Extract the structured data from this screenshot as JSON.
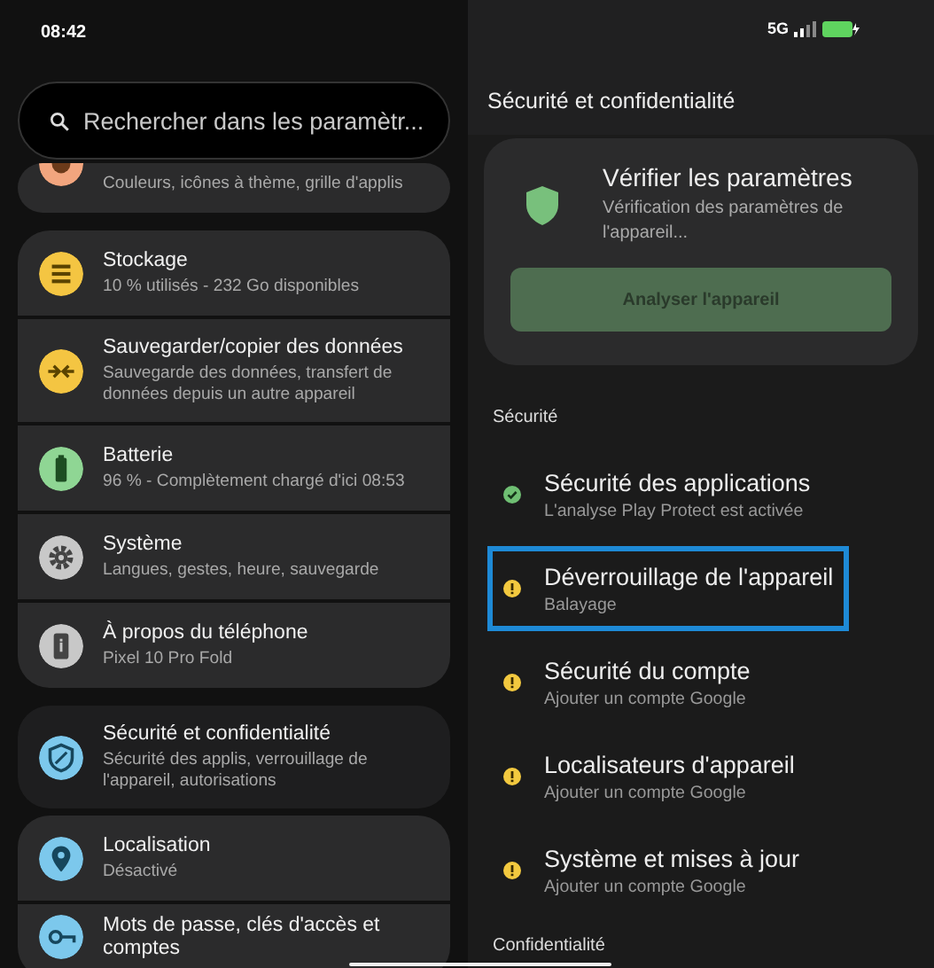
{
  "status_bar": {
    "time": "08:42",
    "network": "5G"
  },
  "search": {
    "placeholder": "Rechercher dans les paramètr..."
  },
  "settings_groups": [
    [
      {
        "kind": "wallpaper",
        "color": "#f2a57e",
        "subtitle": "Couleurs, icônes à thème, grille d'applis",
        "selected": false
      }
    ],
    [
      {
        "kind": "storage",
        "color": "#f4c542",
        "title": "Stockage",
        "subtitle": "10 % utilisés - 232 Go disponibles",
        "selected": false
      },
      {
        "kind": "backup",
        "color": "#f4c542",
        "title": "Sauvegarder/copier des données",
        "subtitle": "Sauvegarde des données, transfert de données depuis un autre appareil",
        "selected": false
      },
      {
        "kind": "battery",
        "color": "#8fd694",
        "title": "Batterie",
        "subtitle": "96 % - Complètement chargé d'ici 08:53",
        "selected": false
      },
      {
        "kind": "system",
        "color": "#c8c8c8",
        "title": "Système",
        "subtitle": "Langues, gestes, heure, sauvegarde",
        "selected": false
      },
      {
        "kind": "about",
        "color": "#c8c8c8",
        "title": "À propos du téléphone",
        "subtitle": "Pixel 10 Pro Fold",
        "selected": false
      }
    ],
    [
      {
        "kind": "security",
        "color": "#7cc8ec",
        "title": "Sécurité et confidentialité",
        "subtitle": "Sécurité des applis, verrouillage de l'appareil, autorisations",
        "selected": true
      }
    ],
    [
      {
        "kind": "location",
        "color": "#7cc8ec",
        "title": "Localisation",
        "subtitle": "Désactivé",
        "selected": false
      },
      {
        "kind": "passwords",
        "color": "#7cc8ec",
        "title": "Mots de passe, clés d'accès et comptes",
        "selected": false
      }
    ]
  ],
  "detail": {
    "title": "Sécurité et confidentialité",
    "check_card": {
      "title": "Vérifier les paramètres",
      "subtitle": "Vérification des paramètres de l'appareil...",
      "button": "Analyser l'appareil",
      "button_disabled": true
    },
    "sections": [
      {
        "heading": "Sécurité",
        "items": [
          {
            "kind": "ok",
            "title": "Sécurité des applications",
            "subtitle": "L'analyse Play Protect est activée",
            "selected": false
          },
          {
            "kind": "warning",
            "title": "Déverrouillage de l'appareil",
            "subtitle": "Balayage",
            "selected": true
          },
          {
            "kind": "warning",
            "title": "Sécurité du compte",
            "subtitle": "Ajouter un compte Google",
            "selected": false
          },
          {
            "kind": "warning",
            "title": "Localisateurs d'appareil",
            "subtitle": "Ajouter un compte Google",
            "selected": false
          },
          {
            "kind": "warning",
            "title": "Système et mises à jour",
            "subtitle": "Ajouter un compte Google",
            "selected": false
          }
        ]
      },
      {
        "heading": "Confidentialité"
      }
    ]
  }
}
